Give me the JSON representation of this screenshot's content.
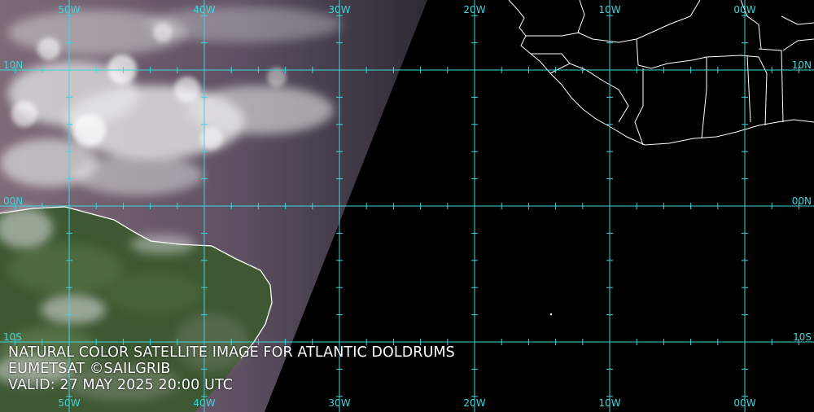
{
  "map": {
    "caption": {
      "title": "NATURAL COLOR SATELLITE IMAGE FOR ATLANTIC DOLDRUMS",
      "credit": "EUMETSAT ©SAILGRIB",
      "valid": "VALID:  27 MAY 2025 20:00 UTC"
    },
    "longitude_labels": [
      "50W",
      "40W",
      "30W",
      "20W",
      "10W",
      "00W"
    ],
    "latitude_labels": [
      "10N",
      "00N",
      "10S"
    ],
    "colors": {
      "grid": "#3fd6dc",
      "ocean_night": "#000000",
      "land_day": "#3f5a33",
      "ocean_day": "#6a5a6a",
      "cloud": "#e6e6e8",
      "coastline": "#ffffff"
    }
  }
}
